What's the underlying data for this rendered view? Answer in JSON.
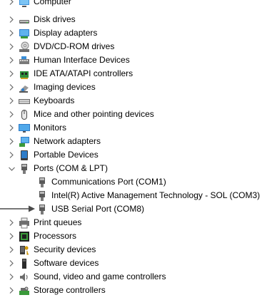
{
  "device_tree": {
    "categories": [
      {
        "label": "Computer",
        "icon": "computer-icon",
        "expanded": false
      },
      {
        "label": "Disk drives",
        "icon": "disk-drive-icon",
        "expanded": false
      },
      {
        "label": "Display adapters",
        "icon": "display-adapter-icon",
        "expanded": false
      },
      {
        "label": "DVD/CD-ROM drives",
        "icon": "dvd-drive-icon",
        "expanded": false
      },
      {
        "label": "Human Interface Devices",
        "icon": "hid-icon",
        "expanded": false
      },
      {
        "label": "IDE ATA/ATAPI controllers",
        "icon": "ide-controller-icon",
        "expanded": false
      },
      {
        "label": "Imaging devices",
        "icon": "camera-icon",
        "expanded": false
      },
      {
        "label": "Keyboards",
        "icon": "keyboard-icon",
        "expanded": false
      },
      {
        "label": "Mice and other pointing devices",
        "icon": "mouse-icon",
        "expanded": false
      },
      {
        "label": "Monitors",
        "icon": "monitor-icon",
        "expanded": false
      },
      {
        "label": "Network adapters",
        "icon": "network-adapter-icon",
        "expanded": false
      },
      {
        "label": "Portable Devices",
        "icon": "portable-device-icon",
        "expanded": false
      },
      {
        "label": "Ports (COM & LPT)",
        "icon": "port-icon",
        "expanded": true,
        "children": [
          {
            "label": "Communications Port (COM1)",
            "icon": "port-icon"
          },
          {
            "label": "Intel(R) Active Management Technology - SOL (COM3)",
            "icon": "port-icon"
          },
          {
            "label": "USB Serial Port (COM8)",
            "icon": "port-icon",
            "highlighted_by_arrow": true
          }
        ]
      },
      {
        "label": "Print queues",
        "icon": "printer-icon",
        "expanded": false
      },
      {
        "label": "Processors",
        "icon": "processor-icon",
        "expanded": false
      },
      {
        "label": "Security devices",
        "icon": "security-device-icon",
        "expanded": false
      },
      {
        "label": "Software devices",
        "icon": "software-device-icon",
        "expanded": false
      },
      {
        "label": "Sound, video and game controllers",
        "icon": "speaker-icon",
        "expanded": false
      },
      {
        "label": "Storage controllers",
        "icon": "storage-controller-icon",
        "expanded": false
      }
    ]
  },
  "colors": {
    "chevron": "#6a6a6a",
    "annotation_arrow": "#4a4a4a"
  }
}
